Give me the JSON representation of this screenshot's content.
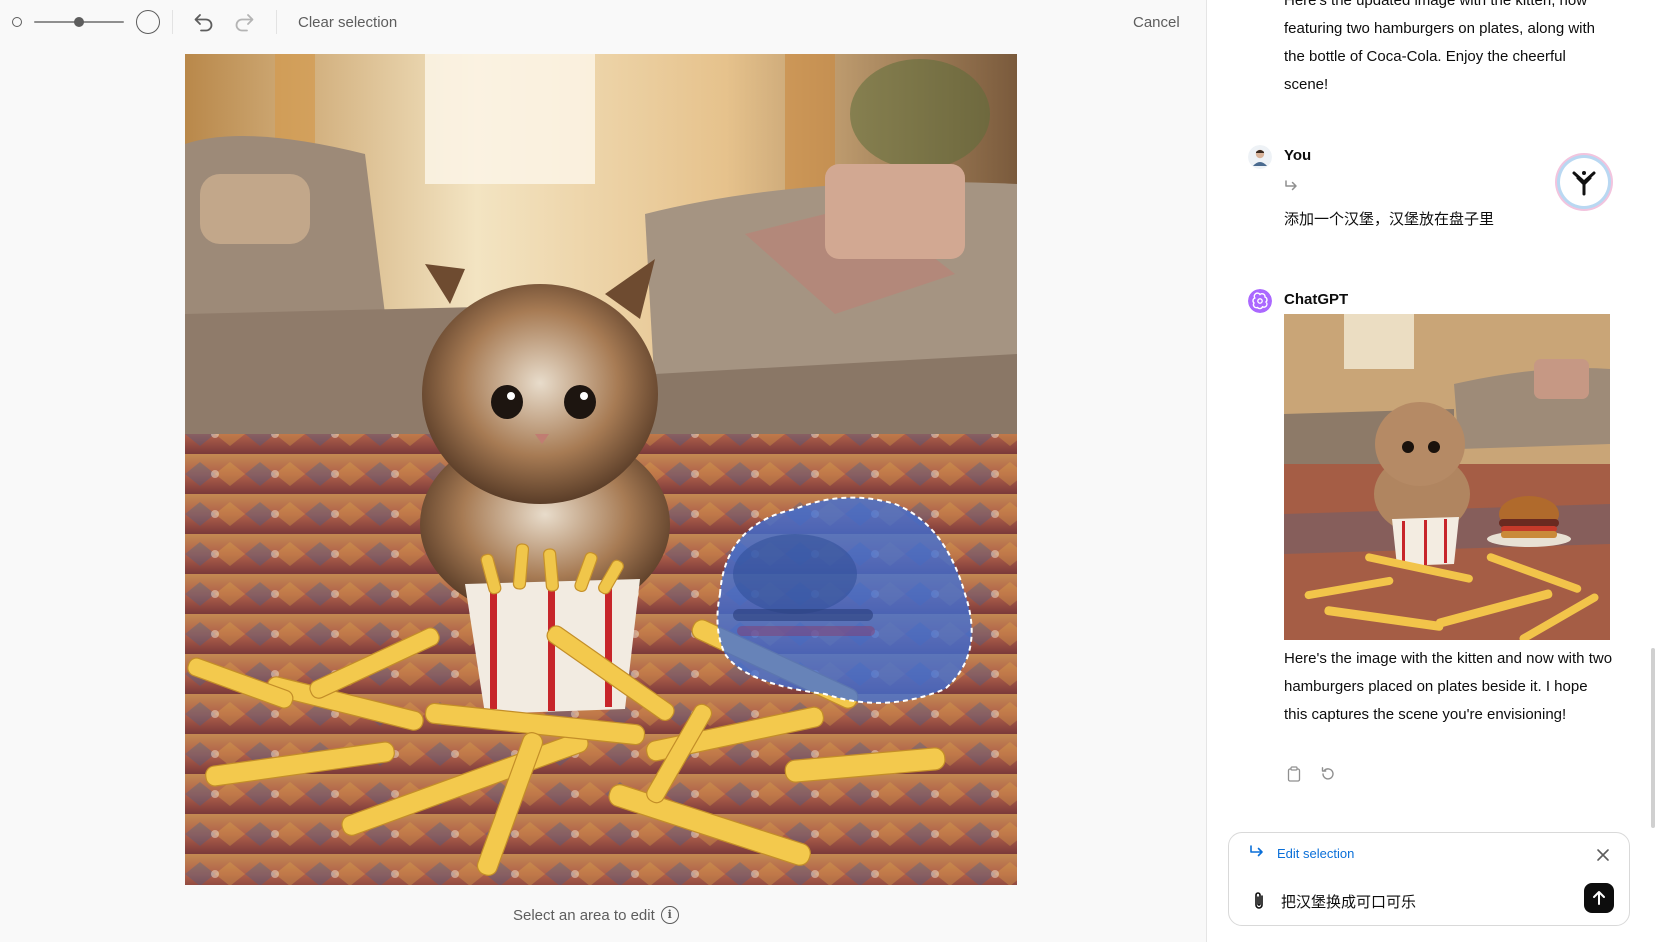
{
  "toolbar": {
    "clear_selection_label": "Clear selection",
    "cancel_label": "Cancel",
    "brush_size_fraction": 0.5,
    "icons": [
      "brush-small-icon",
      "brush-large-icon",
      "undo-icon",
      "redo-icon"
    ]
  },
  "canvas": {
    "hint_text": "Select an area to edit"
  },
  "chat": {
    "previous_message": "Here's the updated image with the kitten, now featuring two hamburgers on plates, along with the bottle of Coca-Cola. Enjoy the cheerful scene!",
    "user": {
      "name": "You",
      "message": "添加一个汉堡，汉堡放在盘子里"
    },
    "assistant": {
      "name": "ChatGPT",
      "message": "Here's the image with the kitten and now with two hamburgers placed on plates beside it. I hope this captures the scene you're envisioning!"
    },
    "composer": {
      "edit_selection_label": "Edit selection",
      "input_value": "把汉堡换成可口可乐"
    }
  },
  "colors": {
    "accent": "#0a6fd8",
    "selection_mask": "#3f6fd6",
    "chatgpt_avatar": "#ab68ff"
  }
}
